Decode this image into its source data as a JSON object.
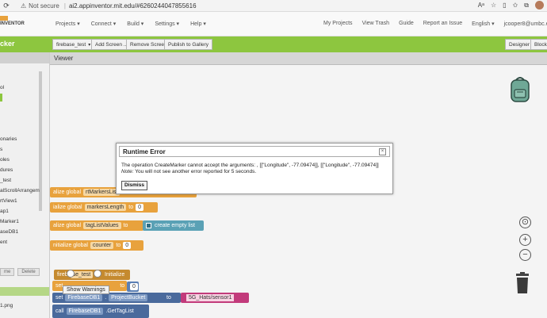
{
  "browser": {
    "security_label": "Not secure",
    "url": "ai2.appinventor.mit.edu/#6260244047855616"
  },
  "header": {
    "logo": "INVENTOR",
    "menu": [
      "Projects ▾",
      "Connect ▾",
      "Build ▾",
      "Settings ▾",
      "Help ▾"
    ],
    "right_menu": [
      "My Projects",
      "View Trash",
      "Guide",
      "Report an Issue",
      "English ▾",
      "jcooper8@umbc.edu ▾"
    ]
  },
  "toolbar": {
    "project_name": "cker",
    "screen_select": "firebase_test",
    "add_screen": "Add Screen ...",
    "remove_screen": "Remove Screen",
    "publish": "Publish to Gallery",
    "designer": "Designer",
    "blocks": "Blocks"
  },
  "palette": {
    "items": [
      "ol",
      "",
      "",
      "",
      "",
      "onaries",
      "s",
      "oles",
      "dures",
      "_test",
      "alScrollArrangem",
      "rtView1",
      "ap1",
      "Marker1",
      "aseDB1",
      "ent"
    ],
    "rename": "me",
    "delete": "Delete",
    "media_file": "1.png"
  },
  "viewer": {
    "title": "Viewer"
  },
  "blocks": {
    "init1": "alize global",
    "init1_var": "rtMarkersList",
    "init2": "ialize global",
    "init2_var": "markersLength",
    "to": "to",
    "zero": "0",
    "init3": "alize global",
    "init3_var": "tagListValues",
    "create_list": "create empty list",
    "init4": "nitialize global",
    "init4_var": "counter",
    "when_component": "fireb",
    "when_component2": "se_test",
    "initialize": "Initialize",
    "set1": "set",
    "set2": "set",
    "firebase": "FirebaseDB1",
    "project_bucket": "ProjectBucket",
    "bucket_value": "5G_Hats/sensor1",
    "call": "call",
    "call_comp": "FirebaseDB1",
    "get_tag": "GetTagList"
  },
  "dialog": {
    "title": "Runtime Error",
    "close": "×",
    "message": "The operation CreateMarker cannot accept the arguments: , [[\"Longitude\", -77.09474]], [[\"Longitude\", -77.09474]]",
    "note_label": "Note:",
    "note_text": " You will not see another error reported for 5 seconds.",
    "dismiss": "Dismiss"
  },
  "workspace": {
    "show_warnings": "Show Warnings",
    "zoom_in": "+",
    "zoom_out": "−"
  },
  "colors": {
    "green": "#8dc63f",
    "control_block": "#e8a23d",
    "component_block": "#4a6a9c",
    "text_block": "#c23b7b"
  }
}
